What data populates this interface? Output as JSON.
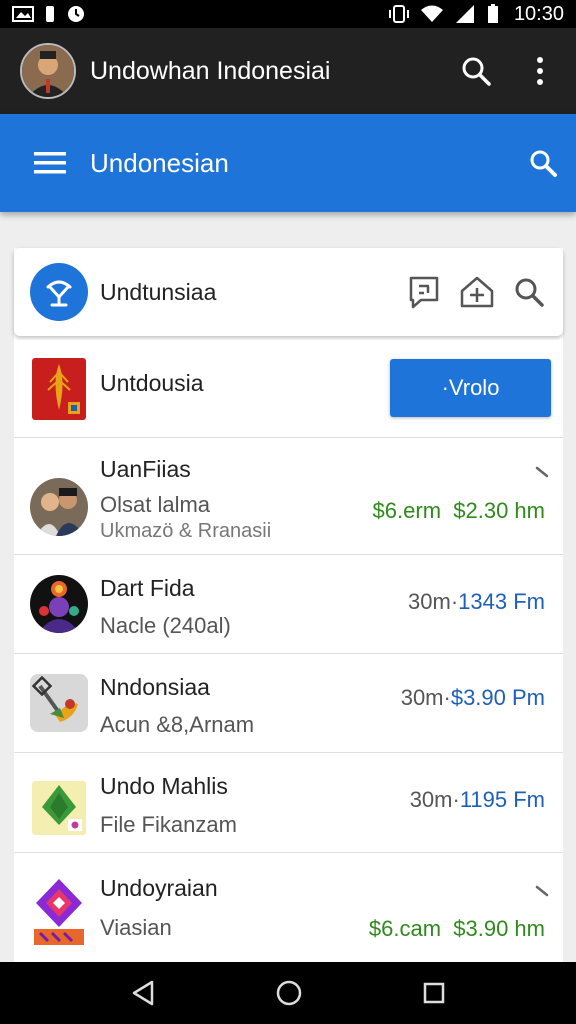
{
  "status_bar": {
    "time": "10:30"
  },
  "app_bar": {
    "title": "Undowhan Indonesiai"
  },
  "toolbar": {
    "title": "Undonesian"
  },
  "header_card": {
    "title": "Undtunsiaa"
  },
  "featured": {
    "title": "Untdousia",
    "action_label": "·Vrolo"
  },
  "items": [
    {
      "title": "UanFiias",
      "subtitle": "Olsat lalma",
      "subtitle2": "Ukmazö & Rranasii",
      "meta_left": "$6.erm",
      "meta_right": "$2.30 hm"
    },
    {
      "title": "Dart Fida",
      "subtitle": "Nacle (240al)",
      "meta_left": "30m",
      "meta_sep": "·",
      "meta_right": "1343 Fm"
    },
    {
      "title": "Nndonsiaa",
      "subtitle": "Acun &8,Arnam",
      "meta_left": "30m",
      "meta_sep": "·",
      "meta_right": "$3.90 Pm"
    },
    {
      "title": "Undo Mahlis",
      "subtitle": "File Fikanzam",
      "meta_left": "30m",
      "meta_sep": "·",
      "meta_right": "1195 Fm"
    },
    {
      "title": "Undoyraian",
      "subtitle": "Viasian",
      "meta_left": "$6.cam",
      "meta_right": "$3.90 hm"
    }
  ],
  "colors": {
    "primary": "#1e74d8",
    "app_bar": "#212121",
    "price_green": "#2e8b1c",
    "price_blue": "#1e5fb8"
  }
}
